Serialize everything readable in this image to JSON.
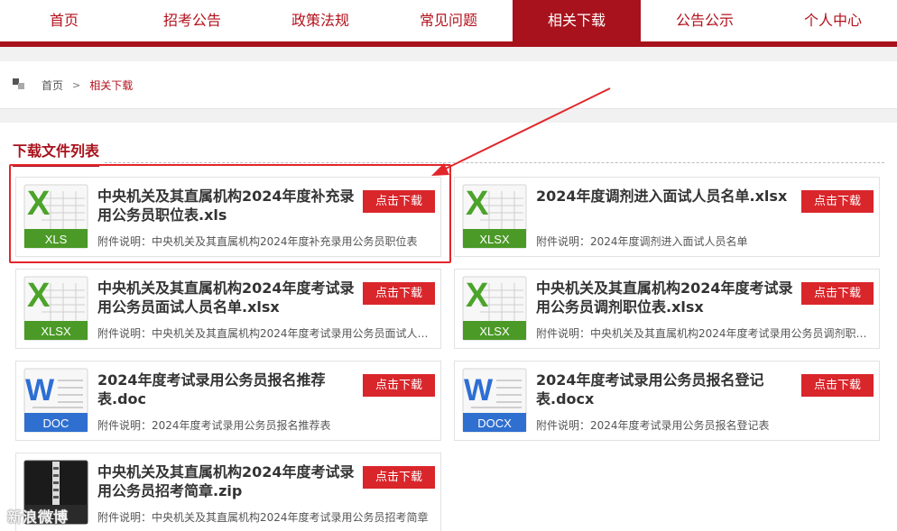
{
  "nav": {
    "items": [
      {
        "label": "首页"
      },
      {
        "label": "招考公告"
      },
      {
        "label": "政策法规"
      },
      {
        "label": "常见问题"
      },
      {
        "label": "相关下载"
      },
      {
        "label": "公告公示"
      },
      {
        "label": "个人中心"
      }
    ],
    "active_index": 4,
    "accent": "#a8121c"
  },
  "breadcrumb": {
    "home": "首页",
    "separator": ">",
    "current": "相关下载"
  },
  "section": {
    "title": "下载文件列表"
  },
  "download_label": "点击下载",
  "files": [
    {
      "name": "中央机关及其直属机构2024年度补充录用公务员职位表.xls",
      "desc": "附件说明：中央机关及其直属机构2024年度补充录用公务员职位表",
      "type": "XLS",
      "icon": "excel-icon"
    },
    {
      "name": "2024年度调剂进入面试人员名单.xlsx",
      "desc": "附件说明：2024年度调剂进入面试人员名单",
      "type": "XLSX",
      "icon": "excel-icon"
    },
    {
      "name": "中央机关及其直属机构2024年度考试录用公务员面试人员名单.xlsx",
      "desc": "附件说明：中央机关及其直属机构2024年度考试录用公务员面试人员名单",
      "type": "XLSX",
      "icon": "excel-icon"
    },
    {
      "name": "中央机关及其直属机构2024年度考试录用公务员调剂职位表.xlsx",
      "desc": "附件说明：中央机关及其直属机构2024年度考试录用公务员调剂职位表",
      "type": "XLSX",
      "icon": "excel-icon"
    },
    {
      "name": "2024年度考试录用公务员报名推荐表.doc",
      "desc": "附件说明：2024年度考试录用公务员报名推荐表",
      "type": "DOC",
      "icon": "word-icon"
    },
    {
      "name": "2024年度考试录用公务员报名登记表.docx",
      "desc": "附件说明：2024年度考试录用公务员报名登记表",
      "type": "DOCX",
      "icon": "word-icon"
    },
    {
      "name": "中央机关及其直属机构2024年度考试录用公务员招考简章.zip",
      "desc": "附件说明：中央机关及其直属机构2024年度考试录用公务员招考简章",
      "type": "ZIP",
      "icon": "zip-icon"
    }
  ],
  "watermark": "新浪微博"
}
